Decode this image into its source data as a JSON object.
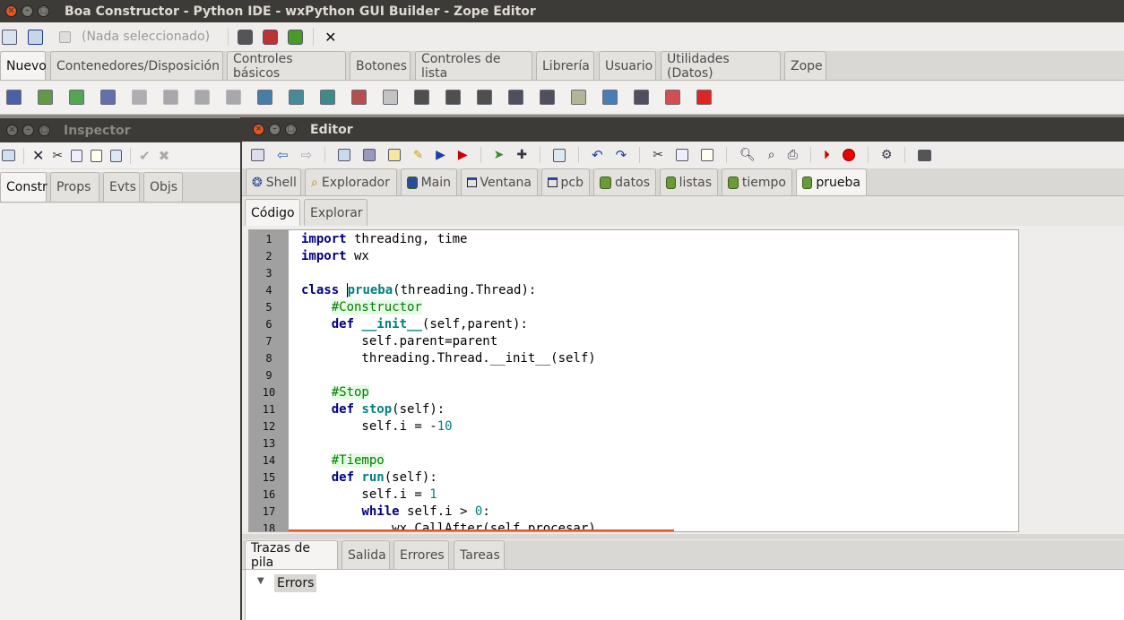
{
  "main_window": {
    "title": "Boa Constructor - Python IDE - wxPython GUI Builder - Zope Editor",
    "selection_label": "(Nada seleccionado)",
    "palette_tabs": [
      "Nuevo",
      "Contenedores/Disposición",
      "Controles básicos",
      "Botones",
      "Controles de lista",
      "Librería",
      "Usuario",
      "Utilidades (Datos)",
      "Zope"
    ],
    "palette_tabs_active": 0,
    "toolbar_icons": [
      "app-icon",
      "module-icon",
      "close-icon"
    ],
    "palette_icons": [
      "python-app-icon",
      "module-icon",
      "package-icon",
      "cube-icon",
      "frame-icon",
      "dialog-icon",
      "mdi-icon",
      "panel-icon",
      "wizard-icon",
      "popup-icon",
      "teal-icon",
      "striped-icon",
      "gray-icon",
      "cut-tool-icon",
      "brush-icon",
      "wand-icon",
      "doc-icon",
      "text-icon",
      "setup-icon",
      "globe-icon",
      "script-icon",
      "image-icon",
      "red-icon"
    ]
  },
  "inspector": {
    "title": "Inspector",
    "tabs": [
      "Constr",
      "Props",
      "Evts",
      "Objs"
    ],
    "active_tab": 0
  },
  "editor": {
    "title": "Editor",
    "file_tabs": [
      "Shell",
      "Explorador",
      "Main",
      "Ventana",
      "pcb",
      "datos",
      "listas",
      "tiempo",
      "prueba"
    ],
    "active_file_tab": 8,
    "view_tabs": [
      "Código",
      "Explorar"
    ],
    "active_view_tab": 0,
    "line_numbers": [
      "1",
      "2",
      "3",
      "4",
      "5",
      "6",
      "7",
      "8",
      "9",
      "10",
      "11",
      "12",
      "13",
      "14",
      "15",
      "16",
      "17",
      "18"
    ],
    "bottom_tabs": [
      "Trazas de pila",
      "Salida",
      "Errores",
      "Tareas"
    ],
    "active_bottom_tab": 0,
    "errors_label": "Errors",
    "errors_toggle": "▼"
  },
  "colors": {
    "title_bar": "#3c3b37",
    "close_button": "#e95420",
    "gutter": "#a0a0a0",
    "keyword": "#00007f",
    "comment": "#007f00"
  }
}
